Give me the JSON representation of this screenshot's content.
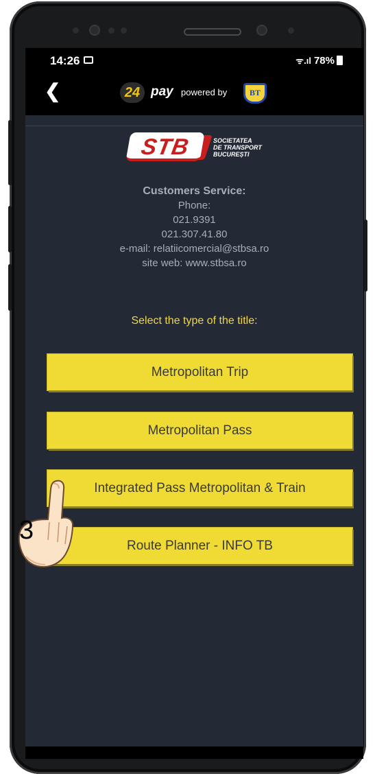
{
  "status": {
    "time": "14:26",
    "signal": "ᯤ.ıl",
    "battery": "78%"
  },
  "header": {
    "logo_24": "24",
    "pay": "pay",
    "powered_by": "powered by",
    "bank_logo": "BT"
  },
  "brand": {
    "name": "STB",
    "line1": "SOCIETATEA",
    "line2": "DE TRANSPORT",
    "line3": "BUCUREȘTI"
  },
  "contact": {
    "title": "Customers Service:",
    "phone_label": "Phone:",
    "phone1": "021.9391",
    "phone2": "021.307.41.80",
    "email": "e-mail: relatiicomercial@stbsa.ro",
    "site": "site web: www.stbsa.ro"
  },
  "prompt": "Select the type of the title:",
  "options": [
    "Metropolitan Trip",
    "Metropolitan Pass",
    "Integrated Pass Metropolitan & Train",
    "Route Planner - INFO TB"
  ],
  "annotation": {
    "step": "3"
  },
  "colors": {
    "screen_bg": "#232a36",
    "button_bg": "#efdb33",
    "prompt_text": "#f1d64a",
    "stb_red": "#c81e1e"
  }
}
